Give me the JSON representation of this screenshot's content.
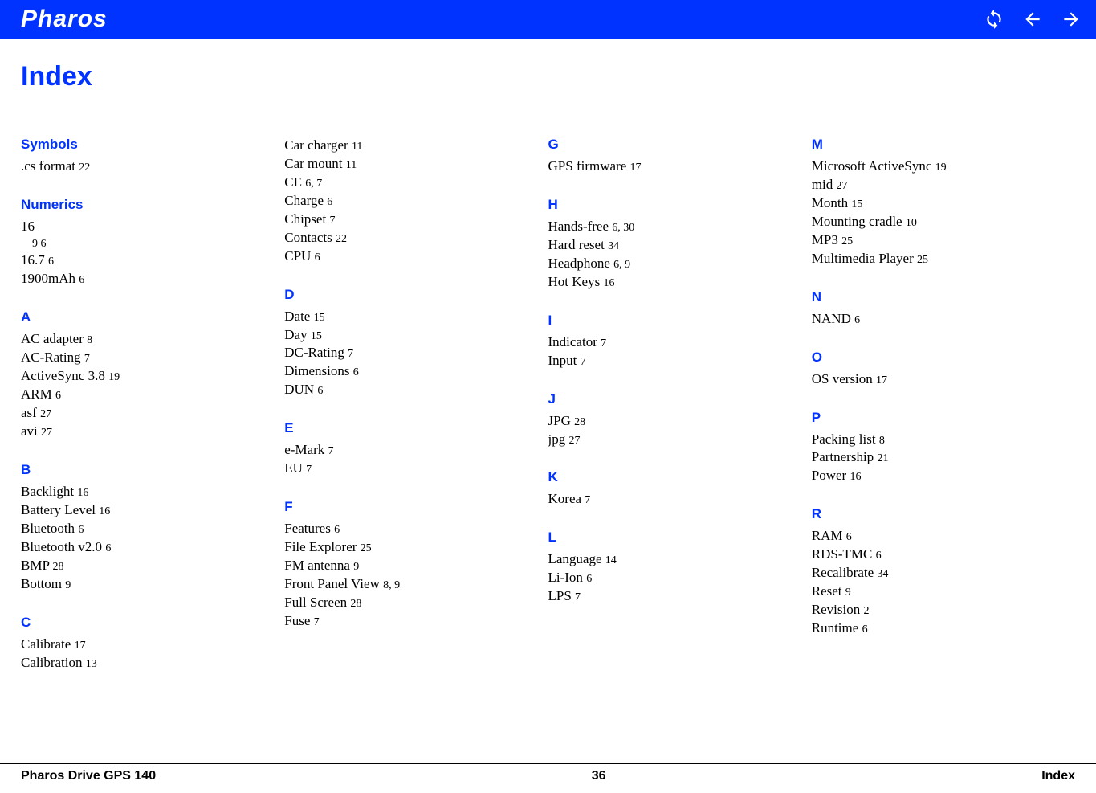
{
  "header": {
    "brand": "Pharos"
  },
  "title": "Index",
  "columns": [
    [
      {
        "heading": "Symbols",
        "entries": [
          {
            "term": ".cs format",
            "pages": "22"
          }
        ]
      },
      {
        "heading": "Numerics",
        "entries": [
          {
            "term": "16",
            "pages": "",
            "sub": {
              "term": "9",
              "pages": "6"
            }
          },
          {
            "term": "16.7",
            "pages": "6"
          },
          {
            "term": "1900mAh",
            "pages": "6"
          }
        ]
      },
      {
        "heading": "A",
        "entries": [
          {
            "term": "AC adapter",
            "pages": "8"
          },
          {
            "term": "AC-Rating",
            "pages": "7"
          },
          {
            "term": "ActiveSync 3.8",
            "pages": "19"
          },
          {
            "term": "ARM",
            "pages": "6"
          },
          {
            "term": "asf",
            "pages": "27"
          },
          {
            "term": "avi",
            "pages": "27"
          }
        ]
      },
      {
        "heading": "B",
        "entries": [
          {
            "term": "Backlight",
            "pages": "16"
          },
          {
            "term": "Battery Level",
            "pages": "16"
          },
          {
            "term": "Bluetooth",
            "pages": "6"
          },
          {
            "term": "Bluetooth v2.0",
            "pages": "6"
          },
          {
            "term": "BMP",
            "pages": "28"
          },
          {
            "term": "Bottom",
            "pages": "9"
          }
        ]
      },
      {
        "heading": "C",
        "entries": [
          {
            "term": "Calibrate",
            "pages": "17"
          },
          {
            "term": "Calibration",
            "pages": "13"
          }
        ]
      }
    ],
    [
      {
        "heading": null,
        "entries": [
          {
            "term": "Car charger",
            "pages": "11"
          },
          {
            "term": "Car mount",
            "pages": "11"
          },
          {
            "term": "CE",
            "pages": "6, 7"
          },
          {
            "term": "Charge",
            "pages": "6"
          },
          {
            "term": "Chipset",
            "pages": "7"
          },
          {
            "term": "Contacts",
            "pages": "22"
          },
          {
            "term": "CPU",
            "pages": "6"
          }
        ]
      },
      {
        "heading": "D",
        "entries": [
          {
            "term": "Date",
            "pages": "15"
          },
          {
            "term": "Day",
            "pages": "15"
          },
          {
            "term": "DC-Rating",
            "pages": "7"
          },
          {
            "term": "Dimensions",
            "pages": "6"
          },
          {
            "term": "DUN",
            "pages": "6"
          }
        ]
      },
      {
        "heading": "E",
        "entries": [
          {
            "term": "e-Mark",
            "pages": "7"
          },
          {
            "term": "EU",
            "pages": "7"
          }
        ]
      },
      {
        "heading": "F",
        "entries": [
          {
            "term": "Features",
            "pages": "6"
          },
          {
            "term": "File Explorer",
            "pages": "25"
          },
          {
            "term": "FM antenna",
            "pages": "9"
          },
          {
            "term": "Front Panel View",
            "pages": "8, 9"
          },
          {
            "term": "Full Screen",
            "pages": "28"
          },
          {
            "term": "Fuse",
            "pages": "7"
          }
        ]
      }
    ],
    [
      {
        "heading": "G",
        "entries": [
          {
            "term": "GPS firmware",
            "pages": "17"
          }
        ]
      },
      {
        "heading": "H",
        "entries": [
          {
            "term": "Hands-free",
            "pages": "6, 30"
          },
          {
            "term": "Hard reset",
            "pages": "34"
          },
          {
            "term": "Headphone",
            "pages": "6, 9"
          },
          {
            "term": "Hot Keys",
            "pages": "16"
          }
        ]
      },
      {
        "heading": "I",
        "entries": [
          {
            "term": "Indicator",
            "pages": "7"
          },
          {
            "term": "Input",
            "pages": "7"
          }
        ]
      },
      {
        "heading": "J",
        "entries": [
          {
            "term": "JPG",
            "pages": "28"
          },
          {
            "term": "jpg",
            "pages": "27"
          }
        ]
      },
      {
        "heading": "K",
        "entries": [
          {
            "term": "Korea",
            "pages": "7"
          }
        ]
      },
      {
        "heading": "L",
        "entries": [
          {
            "term": "Language",
            "pages": "14"
          },
          {
            "term": "Li-Ion",
            "pages": "6"
          },
          {
            "term": "LPS",
            "pages": "7"
          }
        ]
      }
    ],
    [
      {
        "heading": "M",
        "entries": [
          {
            "term": "Microsoft ActiveSync",
            "pages": "19"
          },
          {
            "term": "mid",
            "pages": "27"
          },
          {
            "term": "Month",
            "pages": "15"
          },
          {
            "term": "Mounting cradle",
            "pages": "10"
          },
          {
            "term": "MP3",
            "pages": "25"
          },
          {
            "term": "Multimedia Player",
            "pages": "25"
          }
        ]
      },
      {
        "heading": "N",
        "entries": [
          {
            "term": "NAND",
            "pages": "6"
          }
        ]
      },
      {
        "heading": "O",
        "entries": [
          {
            "term": "OS version",
            "pages": "17"
          }
        ]
      },
      {
        "heading": "P",
        "entries": [
          {
            "term": "Packing list",
            "pages": "8"
          },
          {
            "term": "Partnership",
            "pages": "21"
          },
          {
            "term": "Power",
            "pages": "16"
          }
        ]
      },
      {
        "heading": "R",
        "entries": [
          {
            "term": "RAM",
            "pages": "6"
          },
          {
            "term": "RDS-TMC",
            "pages": "6"
          },
          {
            "term": "Recalibrate",
            "pages": "34"
          },
          {
            "term": "Reset",
            "pages": "9"
          },
          {
            "term": "Revision",
            "pages": "2"
          },
          {
            "term": "Runtime",
            "pages": "6"
          }
        ]
      }
    ]
  ],
  "footer": {
    "left": "Pharos Drive GPS 140",
    "center": "36",
    "right": "Index"
  }
}
